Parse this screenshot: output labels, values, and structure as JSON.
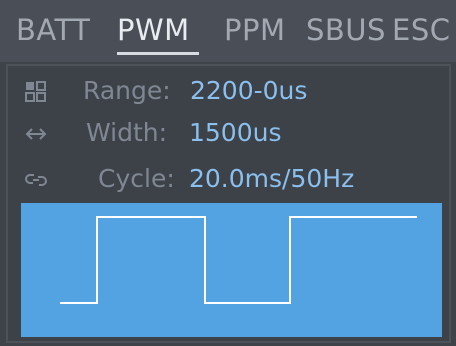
{
  "tabs": [
    {
      "label": "BATT",
      "active": false
    },
    {
      "label": "PWM",
      "active": true
    },
    {
      "label": "PPM",
      "active": false
    },
    {
      "label": "SBUS",
      "active": false
    },
    {
      "label": "ESC",
      "active": false
    }
  ],
  "pwm": {
    "range": {
      "icon": "grid-icon",
      "label": "Range:",
      "value": "2200-0us"
    },
    "width": {
      "icon": "arrows-horizontal-icon",
      "label": "Width:",
      "value": "1500us"
    },
    "cycle": {
      "icon": "cycle-link-icon",
      "label": "Cycle:",
      "value": "20.0ms/50Hz"
    }
  },
  "waveform": {
    "type": "square-wave",
    "pulses_shown": 2,
    "background_color": "#53a3e2",
    "line_color": "#ffffff"
  },
  "colors": {
    "tab_bar": "#4a4f57",
    "background": "#3d4249",
    "label": "#7f8792",
    "value": "#8bbfee",
    "tab_active": "#e8ebef",
    "tab_inactive": "#a3a9b2"
  }
}
